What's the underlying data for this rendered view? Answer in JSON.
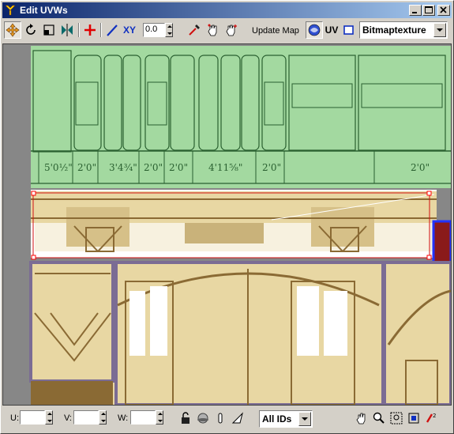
{
  "window": {
    "title": "Edit UVWs"
  },
  "toolbar": {
    "tools": [
      {
        "name": "move-tool-icon",
        "active": true
      },
      {
        "name": "rotate-tool-icon",
        "active": false
      },
      {
        "name": "scale-tool-icon",
        "active": false
      },
      {
        "name": "mirror-tool-icon",
        "active": false
      },
      {
        "name": "weld-tool-icon",
        "active": false
      },
      {
        "name": "pen-tool-icon",
        "active": false
      }
    ],
    "xy_label": "XY",
    "spinner_value": "0.0",
    "update_map_label": "Update Map",
    "uv_label": "UV",
    "texture_dropdown": "Bitmaptexture"
  },
  "canvas": {
    "dimension_labels": [
      "5'0½\"",
      "2'0\"",
      "3'4¾\"",
      "2'0\"",
      "2'0\"",
      "4'11⅝\"",
      "2'0\"",
      "2'0\""
    ],
    "colors": {
      "background": "#878787",
      "green_panel": "#a3d9a0",
      "beige": "#e8d7a3",
      "selection": "#ff0000",
      "blue_mark": "#2233ff",
      "frame": "#7b6c94",
      "brown": "#8a6a34"
    }
  },
  "bottombar": {
    "u_label": "U:",
    "v_label": "V:",
    "w_label": "W:",
    "u_value": "",
    "v_value": "",
    "w_value": "",
    "ids_dropdown": "All IDs"
  }
}
